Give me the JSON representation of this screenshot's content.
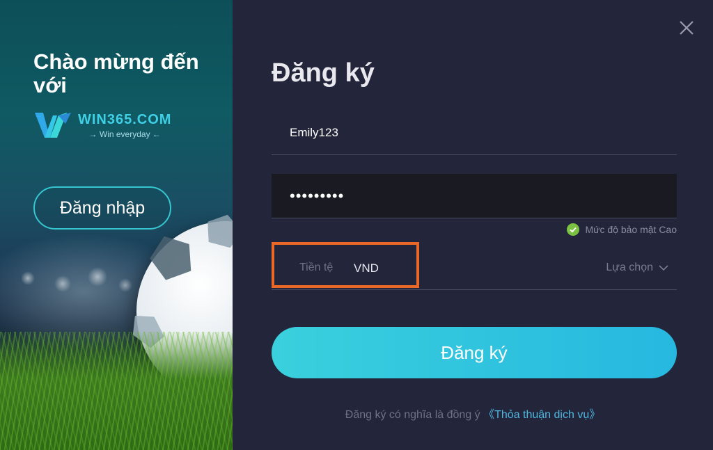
{
  "left_panel": {
    "welcome_line": "Chào mừng đến với",
    "brand_name": "WIN365.COM",
    "brand_tagline": "→ Win everyday ←",
    "login_button": "Đăng nhập"
  },
  "form": {
    "title": "Đăng ký",
    "username_value": "Emily123",
    "password_value": "•••••••••",
    "password_strength": "Mức độ bảo mật Cao",
    "currency_label": "Tiền tệ",
    "currency_value": "VND",
    "currency_select": "Lựa chọn",
    "submit_button": "Đăng ký",
    "terms_text": "Đăng ký có nghĩa là đồng ý ",
    "terms_link": "《Thỏa thuận dịch vụ》"
  },
  "colors": {
    "accent": "#3ad0dd",
    "background": "#23253a",
    "highlight": "#e8682a",
    "success": "#7cc242"
  },
  "icons": {
    "close": "close-icon",
    "strength": "check-circle-icon",
    "dropdown": "chevron-down-icon",
    "brand": "win365-logo-icon"
  }
}
